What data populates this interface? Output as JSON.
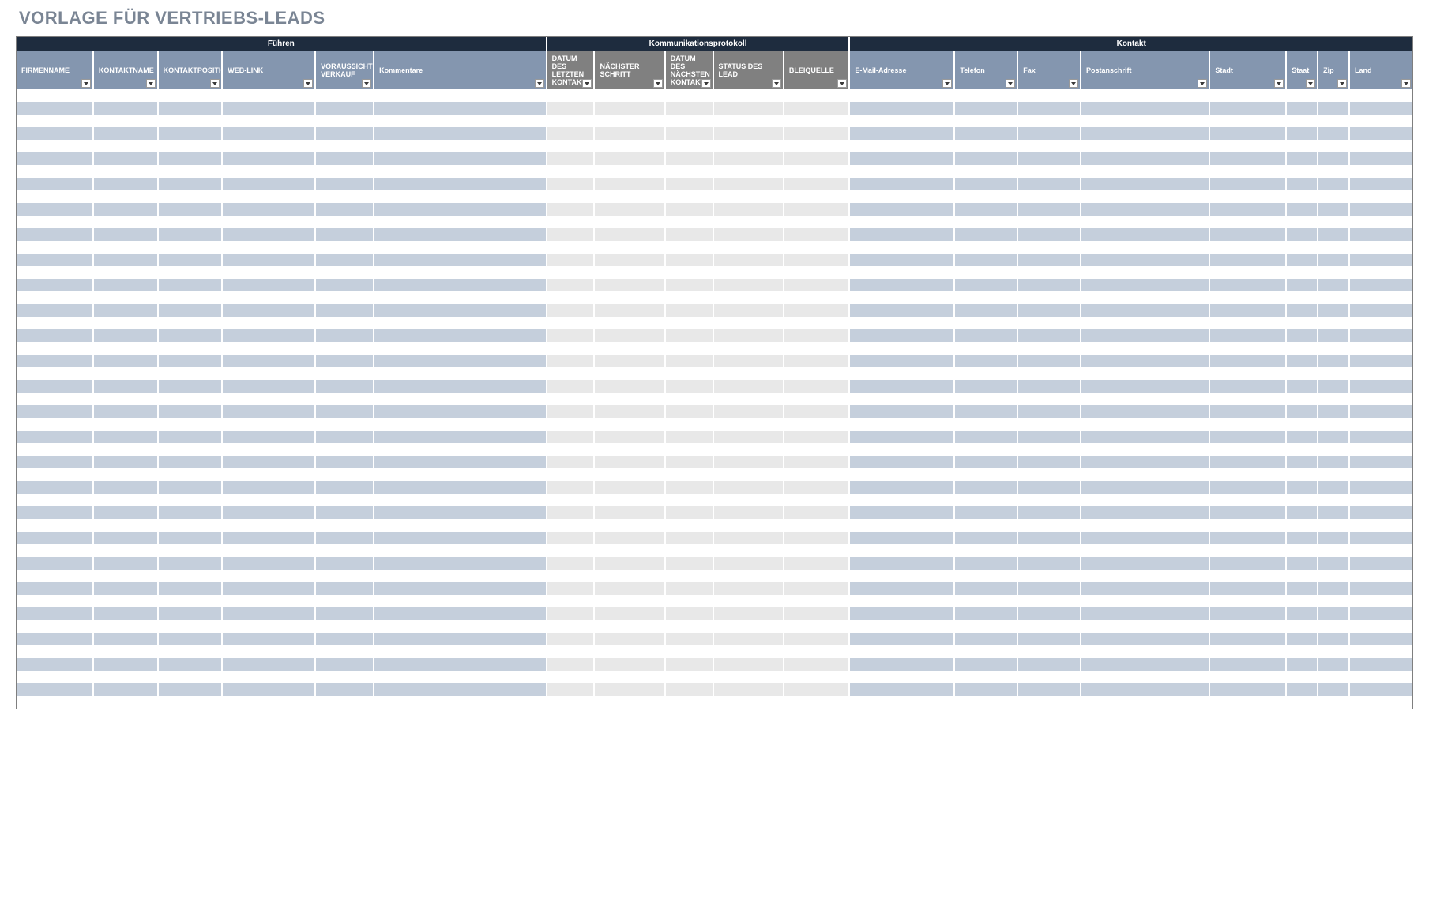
{
  "title": "VORLAGE FÜR VERTRIEBS-LEADS",
  "sections": {
    "lead": "Führen",
    "comm": "Kommunikationsprotokoll",
    "contact": "Kontakt"
  },
  "columns": {
    "firmenname": "FIRMENNAME",
    "kontaktname": "KONTAKTNAME",
    "kontaktposition": "KONTAKTPOSITION",
    "weblink": "WEB-LINK",
    "voraussichtlicher_verkauf": "VORAUSSICHTLICHER VERKAUF",
    "kommentare": "Kommentare",
    "datum_letzten_kontakt": "DATUM DES LETZTEN KONTAKT",
    "naechster_schritt": "NÄCHSTER SCHRITT",
    "datum_naechsten_kontakt": "DATUM DES NÄCHSTEN KONTAKT",
    "status_des_lead": "STATUS DES LEAD",
    "bleiquelle": "BLEIQUELLE",
    "email": "E-Mail-Adresse",
    "telefon": "Telefon",
    "fax": "Fax",
    "postanschrift": "Postanschrift",
    "stadt": "Stadt",
    "staat": "Staat",
    "zip": "Zip",
    "land": "Land"
  },
  "row_count": 49,
  "colors": {
    "section_header_bg": "#1e2c3e",
    "col_header_blue": "#8496af",
    "col_header_gray": "#808080",
    "row_stripe_blue": "#c5cfdc",
    "row_stripe_gray": "#e8e8e8",
    "title_text": "#7a8594"
  }
}
